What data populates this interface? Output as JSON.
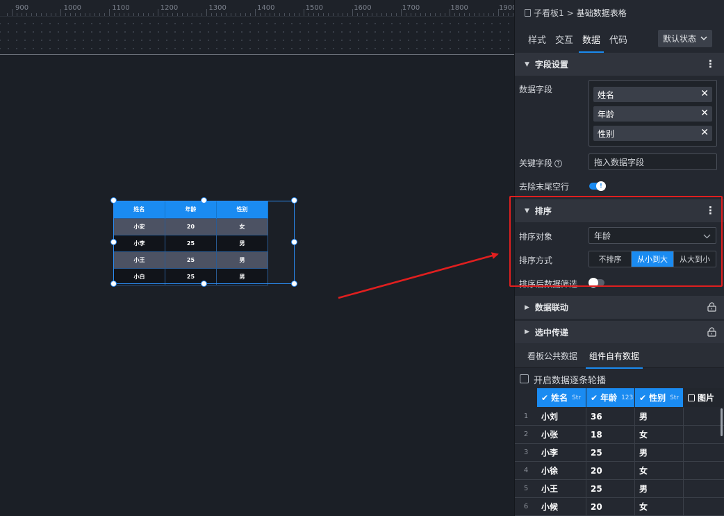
{
  "ruler": {
    "labels": [
      "900",
      "1000",
      "1100",
      "1200",
      "1300",
      "1400",
      "1500",
      "1600",
      "1700",
      "1800",
      "1900"
    ]
  },
  "mini_table": {
    "headers": [
      "姓名",
      "年龄",
      "性别"
    ],
    "rows": [
      [
        "小安",
        "20",
        "女"
      ],
      [
        "小李",
        "25",
        "男"
      ],
      [
        "小王",
        "25",
        "男"
      ],
      [
        "小白",
        "25",
        "男"
      ]
    ]
  },
  "panel": {
    "breadcrumb": {
      "parent": "子看板1",
      "sep": ">",
      "current": "基础数据表格"
    },
    "tabs": [
      "样式",
      "交互",
      "数据",
      "代码"
    ],
    "active_tab": "数据",
    "state_select": "默认状态",
    "field_section": {
      "title": "字段设置",
      "data_fields_label": "数据字段",
      "fields": [
        "姓名",
        "年龄",
        "性别"
      ],
      "key_field_label": "关键字段",
      "key_field_placeholder": "拖入数据字段",
      "trim_label": "去除末尾空行",
      "trim_on": true
    },
    "sort_section": {
      "title": "排序",
      "target_label": "排序对象",
      "target_value": "年龄",
      "method_label": "排序方式",
      "methods": [
        "不排序",
        "从小到大",
        "从大到小"
      ],
      "method_selected": "从小到大",
      "filter_label": "排序后数据筛选",
      "filter_on": false
    },
    "linkage_section": {
      "title": "数据联动",
      "locked": true
    },
    "transfer_section": {
      "title": "选中传递",
      "locked": true
    },
    "data_tabs": [
      "看板公共数据",
      "组件自有数据"
    ],
    "data_tab_active": "组件自有数据",
    "carousel_label": "开启数据逐条轮播",
    "grid": {
      "columns": [
        {
          "name": "姓名",
          "type": "Str",
          "checked": true
        },
        {
          "name": "年龄",
          "type": "123",
          "checked": true
        },
        {
          "name": "性别",
          "type": "Str",
          "checked": true
        },
        {
          "name": "图片",
          "type": "",
          "checked": false
        }
      ],
      "rows": [
        {
          "n": "1",
          "cells": [
            "小刘",
            "36",
            "男"
          ]
        },
        {
          "n": "2",
          "cells": [
            "小张",
            "18",
            "女"
          ]
        },
        {
          "n": "3",
          "cells": [
            "小李",
            "25",
            "男"
          ]
        },
        {
          "n": "4",
          "cells": [
            "小徐",
            "20",
            "女"
          ]
        },
        {
          "n": "5",
          "cells": [
            "小王",
            "25",
            "男"
          ]
        },
        {
          "n": "6",
          "cells": [
            "小候",
            "20",
            "女"
          ]
        }
      ]
    }
  },
  "colors": {
    "accent": "#1a8bf1",
    "annotation": "#e01f1f"
  }
}
